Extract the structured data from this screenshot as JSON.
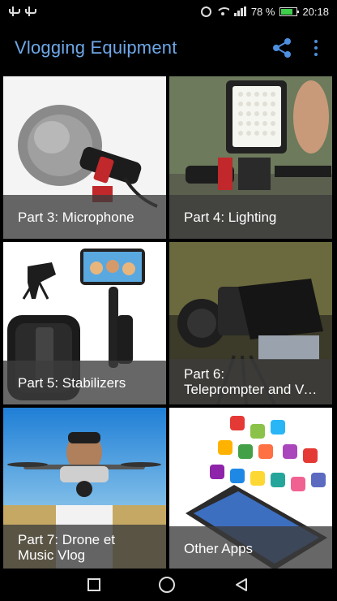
{
  "status_bar": {
    "battery_text": "78 %",
    "time": "20:18",
    "battery_level": 0.78,
    "icons": [
      "usb-icon",
      "usb-icon",
      "alarm-icon",
      "wifi-icon",
      "signal-icon",
      "battery-icon"
    ]
  },
  "app_bar": {
    "title": "Vlogging Equipment",
    "accent_color": "#6ea7e8",
    "icons": [
      "share-icon",
      "more-vert-icon"
    ]
  },
  "tiles": [
    {
      "label": "Part 3: Microphone"
    },
    {
      "label": "Part 4: Lighting"
    },
    {
      "label": "Part 5: Stabilizers"
    },
    {
      "label_line1": "Part 6:",
      "label_line2": "Teleprompter and Voice Recorder"
    },
    {
      "label_line1": "Part 7: Drone et",
      "label_line2": "Music Vlog"
    },
    {
      "label": "Other Apps"
    }
  ],
  "nav_bar": {
    "icons": [
      "recent-apps-icon",
      "home-icon",
      "back-icon"
    ]
  }
}
